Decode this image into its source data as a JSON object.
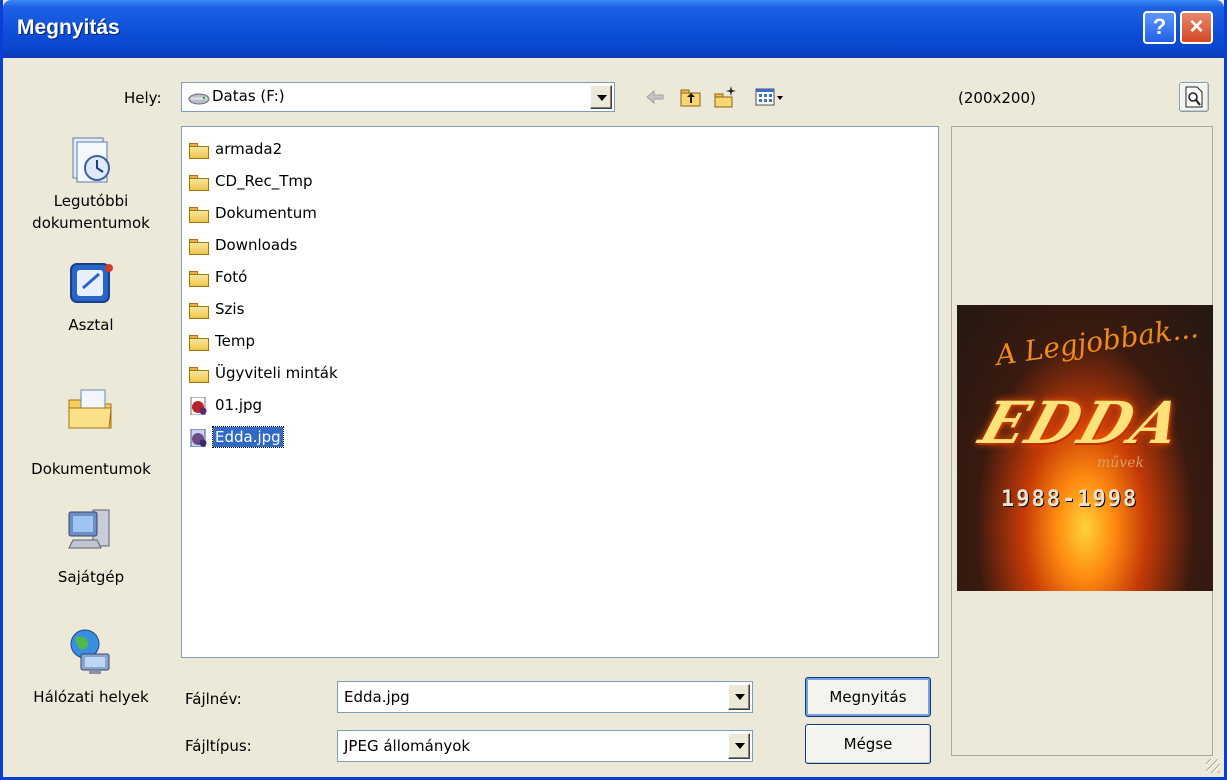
{
  "window": {
    "title": "Megnyitás"
  },
  "titlebar": {
    "help_label": "?",
    "close_label": "×"
  },
  "location": {
    "label": "Hely:",
    "value": "Datas (F:)"
  },
  "toolbar": {
    "back_icon": "back-arrow-icon",
    "up_icon": "up-folder-icon",
    "new_folder_icon": "new-folder-icon",
    "view_icon": "view-menu-icon"
  },
  "preview": {
    "size_label": "(200x200)",
    "image_script": "A Legjobbak...",
    "image_logo": "EDDA",
    "image_sub": "művek",
    "image_years": "1988-1998"
  },
  "places": [
    {
      "label": "Legutóbbi dokumentumok",
      "icon": "recent-documents-icon"
    },
    {
      "label": "Asztal",
      "icon": "desktop-icon"
    },
    {
      "label": "Dokumentumok",
      "icon": "my-documents-icon"
    },
    {
      "label": "Sajátgép",
      "icon": "my-computer-icon"
    },
    {
      "label": "Hálózati helyek",
      "icon": "network-places-icon"
    }
  ],
  "files": [
    {
      "name": "armada2",
      "type": "folder"
    },
    {
      "name": "CD_Rec_Tmp",
      "type": "folder"
    },
    {
      "name": "Dokumentum",
      "type": "folder"
    },
    {
      "name": "Downloads",
      "type": "folder"
    },
    {
      "name": "Fotó",
      "type": "folder"
    },
    {
      "name": "Szis",
      "type": "folder"
    },
    {
      "name": "Temp",
      "type": "folder"
    },
    {
      "name": "Ügyviteli minták",
      "type": "folder"
    },
    {
      "name": "01.jpg",
      "type": "image"
    },
    {
      "name": "Edda.jpg",
      "type": "image",
      "selected": true
    }
  ],
  "filename": {
    "label": "Fájlnév:",
    "value": "Edda.jpg"
  },
  "filetype": {
    "label": "Fájltípus:",
    "value": "JPEG állományok"
  },
  "buttons": {
    "open": "Megnyitás",
    "cancel": "Mégse"
  }
}
